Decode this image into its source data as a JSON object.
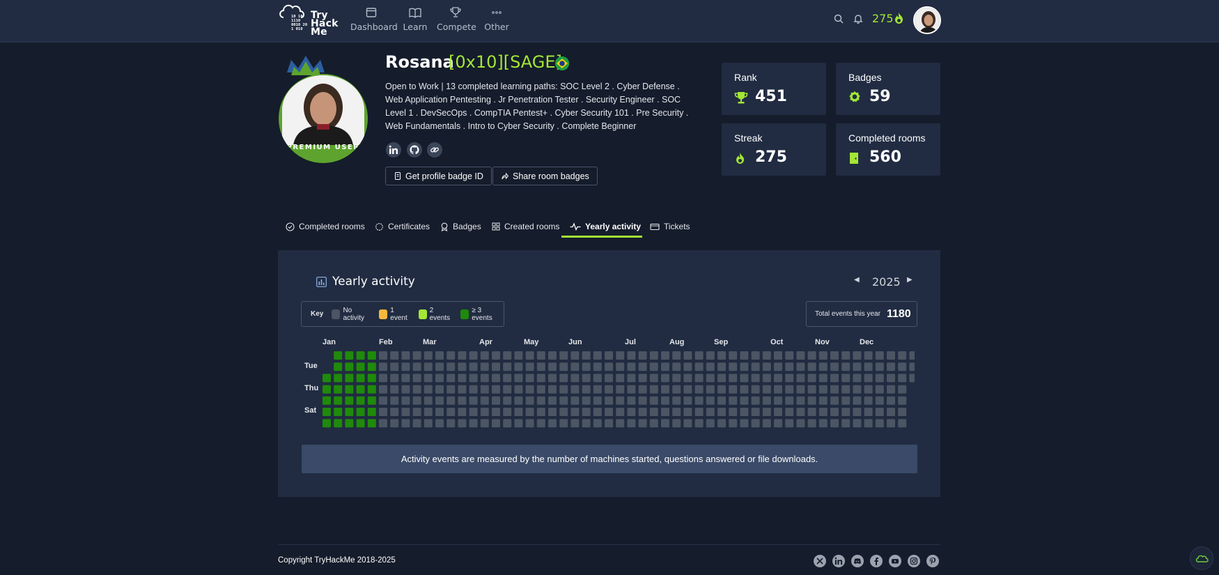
{
  "nav": {
    "logo_text": [
      "Try",
      "Hack",
      "Me"
    ],
    "logo_binary": [
      "10  10",
      "1110",
      "0010  20",
      "1  010"
    ],
    "items": [
      {
        "label": "Dashboard",
        "icon": "dashboard-icon"
      },
      {
        "label": "Learn",
        "icon": "book-icon"
      },
      {
        "label": "Compete",
        "icon": "trophy-icon"
      },
      {
        "label": "Other",
        "icon": "more-icon"
      }
    ],
    "streak": "275"
  },
  "profile": {
    "username": "Rosana",
    "title": "[0x10][SAGE]",
    "premium_label": "PREMIUM USER",
    "bio": "Open to Work | 13 completed learning paths: SOC Level 2 . Cyber Defense . Web Application Pentesting . Jr Penetration Tester . Security Engineer . SOC Level 1 . DevSecOps . CompTIA Pentest+ . Cyber Security 101 . Pre Security . Web Fundamentals . Intro to Cyber Security . Complete Beginner",
    "buttons": {
      "badge_id": "Get profile badge ID",
      "share": "Share room badges"
    }
  },
  "stats": {
    "rank": {
      "label": "Rank",
      "value": "451"
    },
    "badges": {
      "label": "Badges",
      "value": "59"
    },
    "streak": {
      "label": "Streak",
      "value": "275"
    },
    "rooms": {
      "label": "Completed rooms",
      "value": "560"
    }
  },
  "tabs": [
    {
      "label": "Completed rooms",
      "icon": "check-circle-icon"
    },
    {
      "label": "Certificates",
      "icon": "certificate-icon"
    },
    {
      "label": "Badges",
      "icon": "badge-icon"
    },
    {
      "label": "Created rooms",
      "icon": "grid-icon"
    },
    {
      "label": "Yearly activity",
      "icon": "activity-icon",
      "active": true
    },
    {
      "label": "Tickets",
      "icon": "ticket-icon"
    }
  ],
  "activity": {
    "title": "Yearly activity",
    "year": "2025",
    "key_title": "Key",
    "key": [
      {
        "label": "No activity",
        "color": "#4b5563"
      },
      {
        "label": "1 event",
        "color": "#f6b73c"
      },
      {
        "label": "2 events",
        "color": "#a3e635"
      },
      {
        "label": "≥ 3 events",
        "color": "#1f8a0b"
      }
    ],
    "total_label": "Total events this year",
    "total_value": "1180",
    "months": [
      "Jan",
      "Feb",
      "Mar",
      "Apr",
      "May",
      "Jun",
      "Jul",
      "Aug",
      "Sep",
      "Oct",
      "Nov",
      "Dec"
    ],
    "days": [
      "Tue",
      "Thu",
      "Sat"
    ],
    "active_weeks": 5,
    "note": "Activity events are measured by the number of machines started, questions answered or file downloads."
  },
  "footer": {
    "copyright": "Copyright TryHackMe 2018-2025",
    "social": [
      "x-icon",
      "linkedin-icon",
      "discord-icon",
      "facebook-icon",
      "youtube-icon",
      "instagram-icon",
      "pinterest-icon"
    ]
  }
}
